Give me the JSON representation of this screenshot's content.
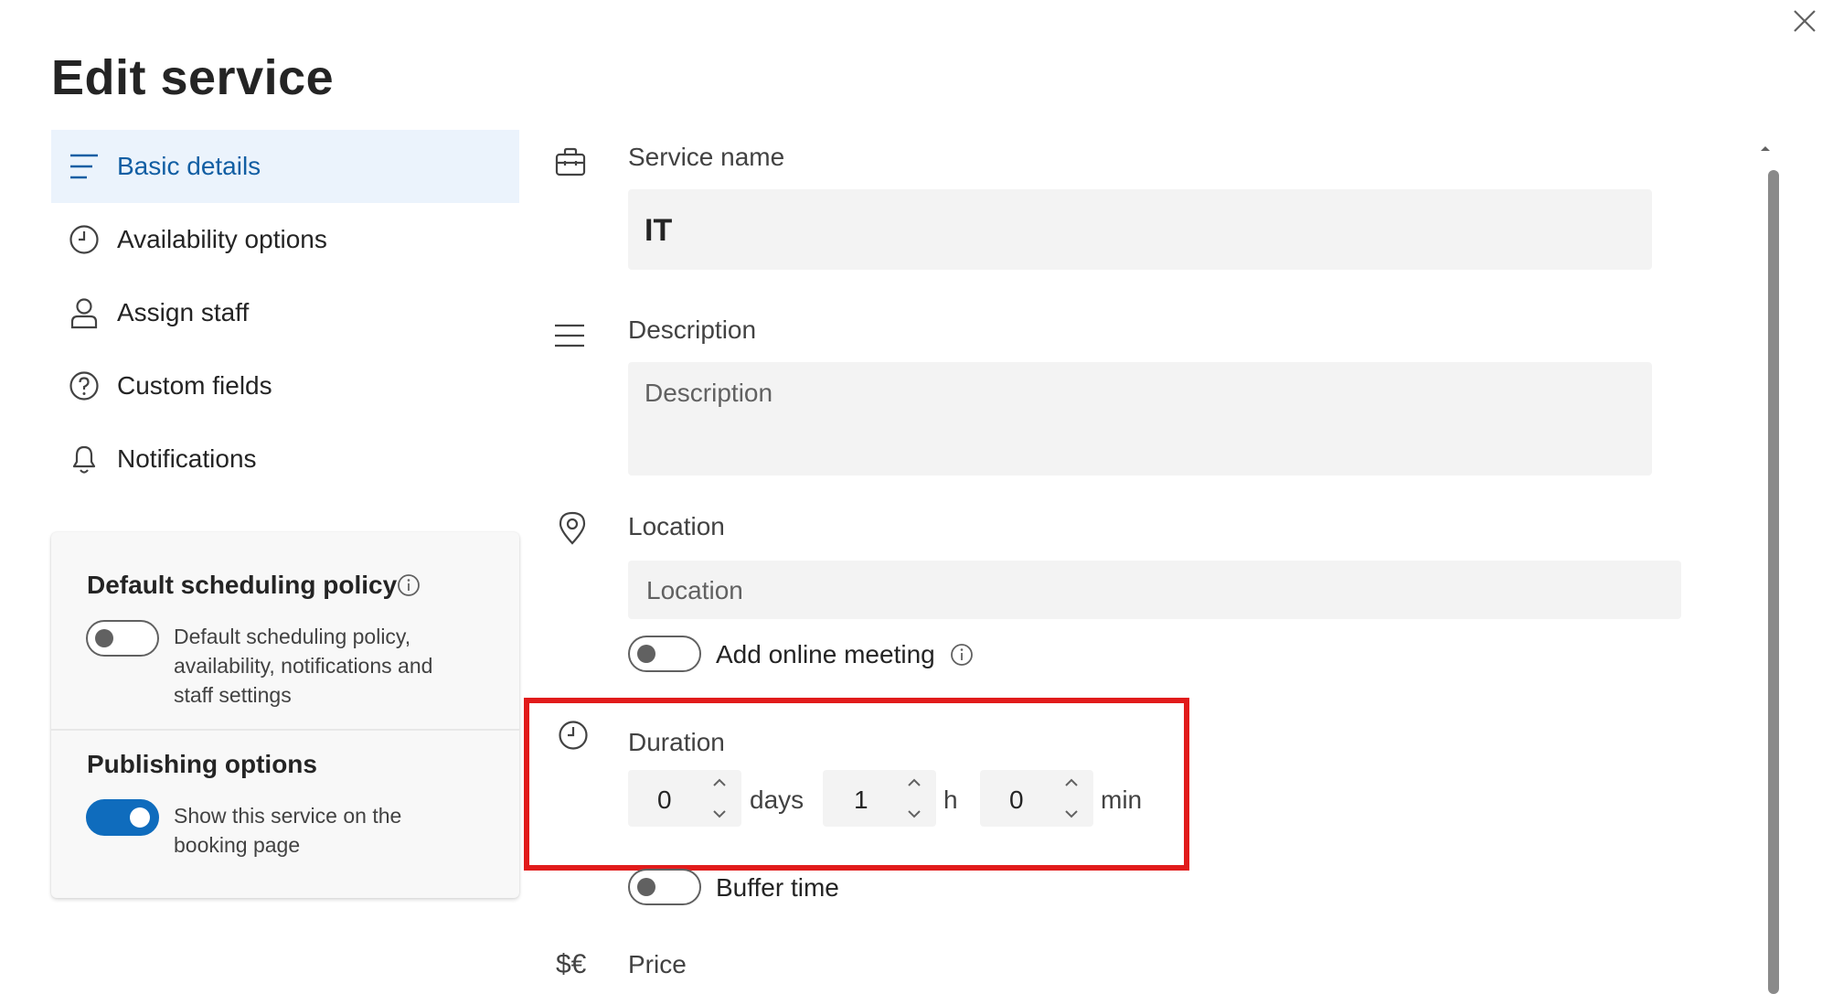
{
  "dialog": {
    "title": "Edit service",
    "close_icon": "close-icon"
  },
  "nav": {
    "items": [
      {
        "label": "Basic details",
        "icon": "list-icon",
        "active": true
      },
      {
        "label": "Availability options",
        "icon": "clock-icon",
        "active": false
      },
      {
        "label": "Assign staff",
        "icon": "person-icon",
        "active": false
      },
      {
        "label": "Custom fields",
        "icon": "question-icon",
        "active": false
      },
      {
        "label": "Notifications",
        "icon": "bell-icon",
        "active": false
      }
    ]
  },
  "policy": {
    "heading": "Default scheduling policy",
    "toggle_on": false,
    "text_lines": [
      "Default scheduling policy,",
      "availability, notifications and",
      "staff settings"
    ]
  },
  "publishing": {
    "heading": "Publishing options",
    "toggle_on": true,
    "text_lines": [
      "Show this service on the",
      "booking page"
    ]
  },
  "form": {
    "service_name": {
      "label": "Service name",
      "value": "IT"
    },
    "description": {
      "label": "Description",
      "placeholder": "Description"
    },
    "location": {
      "label": "Location",
      "placeholder": "Location"
    },
    "online_meeting": {
      "label": "Add online meeting",
      "toggle_on": false
    },
    "duration": {
      "label": "Duration",
      "days": {
        "value": "0",
        "unit": "days"
      },
      "hours": {
        "value": "1",
        "unit": "h"
      },
      "minutes": {
        "value": "0",
        "unit": "min"
      }
    },
    "buffer_time": {
      "label": "Buffer time",
      "toggle_on": false
    },
    "price": {
      "label": "Price",
      "icon_text": "$€"
    }
  },
  "colors": {
    "accent": "#0f6cbd",
    "active_nav_bg": "#ebf3fc",
    "highlight": "#e11b1b"
  }
}
